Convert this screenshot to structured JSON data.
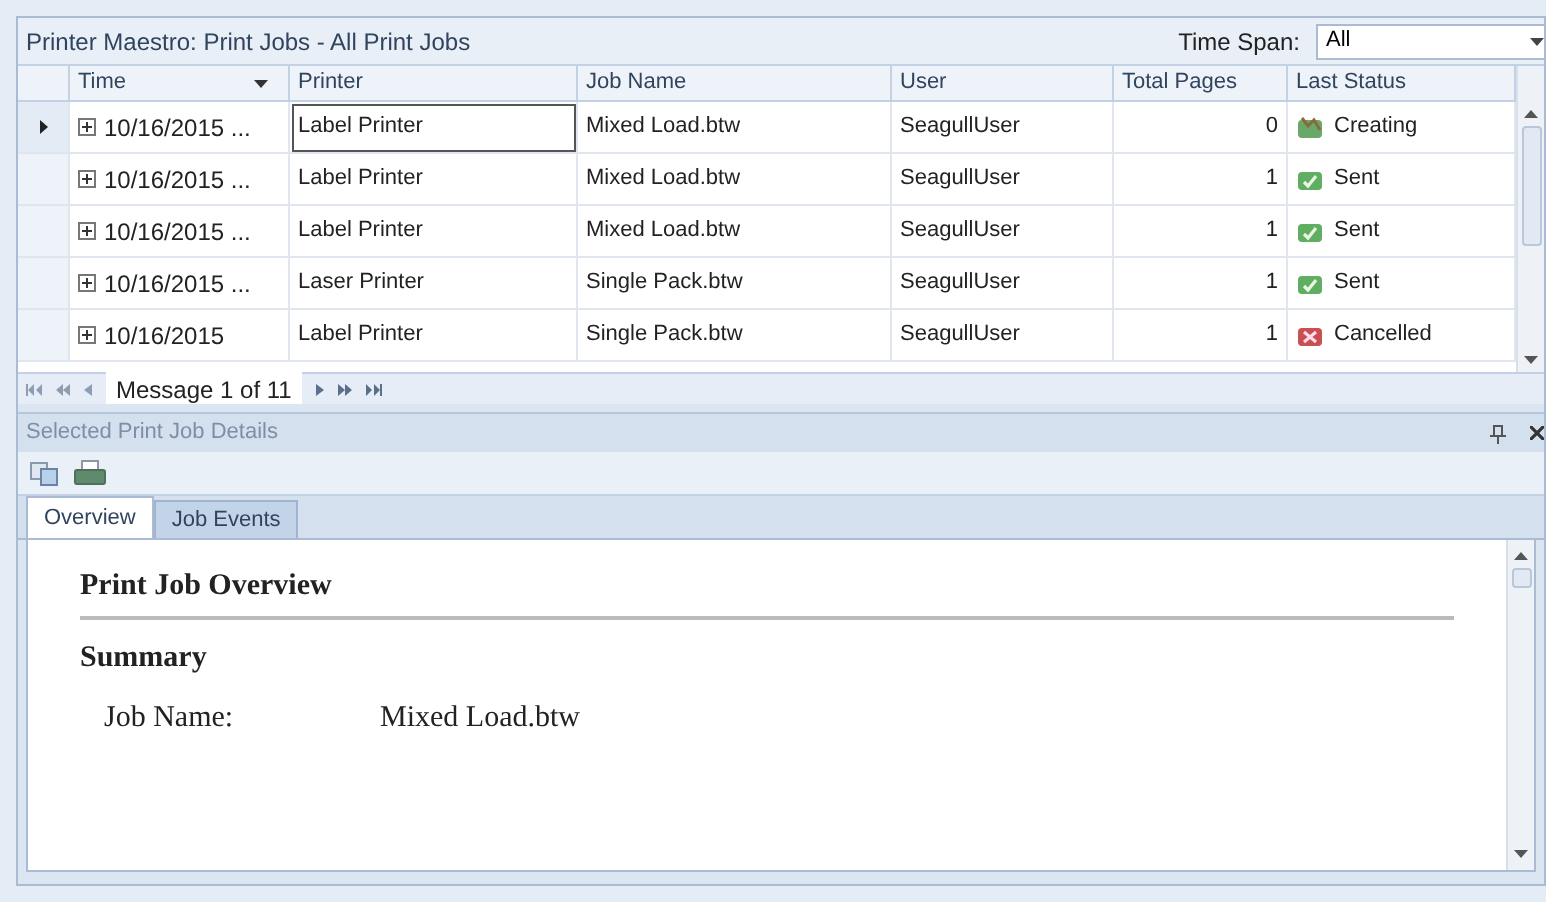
{
  "window": {
    "title": "Printer Maestro: Print Jobs - All Print Jobs"
  },
  "time_span": {
    "label": "Time Span:",
    "value": "All"
  },
  "table": {
    "columns": [
      {
        "label": "Time",
        "sorted": true
      },
      {
        "label": "Printer",
        "sorted": false
      },
      {
        "label": "Job Name",
        "sorted": false
      },
      {
        "label": "User",
        "sorted": false
      },
      {
        "label": "Total Pages",
        "sorted": false
      },
      {
        "label": "Last Status",
        "sorted": false
      }
    ],
    "rows": [
      {
        "selected": true,
        "time": "10/16/2015 ...",
        "printer": "Label Printer",
        "job_name": "Mixed Load.btw",
        "user": "SeagullUser",
        "total_pages": "0",
        "status": {
          "kind": "creating",
          "label": "Creating"
        }
      },
      {
        "selected": false,
        "time": "10/16/2015 ...",
        "printer": "Label Printer",
        "job_name": "Mixed Load.btw",
        "user": "SeagullUser",
        "total_pages": "1",
        "status": {
          "kind": "sent",
          "label": "Sent"
        }
      },
      {
        "selected": false,
        "time": "10/16/2015 ...",
        "printer": "Label Printer",
        "job_name": "Mixed Load.btw",
        "user": "SeagullUser",
        "total_pages": "1",
        "status": {
          "kind": "sent",
          "label": "Sent"
        }
      },
      {
        "selected": false,
        "time": "10/16/2015 ...",
        "printer": "Laser Printer",
        "job_name": "Single Pack.btw",
        "user": "SeagullUser",
        "total_pages": "1",
        "status": {
          "kind": "sent",
          "label": "Sent"
        }
      },
      {
        "selected": false,
        "time": "10/16/2015",
        "printer": "Label Printer",
        "job_name": "Single Pack.btw",
        "user": "SeagullUser",
        "total_pages": "1",
        "status": {
          "kind": "cancelled",
          "label": "Cancelled"
        }
      }
    ]
  },
  "pager": {
    "text": "Message 1 of 11"
  },
  "details": {
    "title": "Selected Print Job Details",
    "tabs": [
      {
        "label": "Overview",
        "selected": true
      },
      {
        "label": "Job Events",
        "selected": false
      }
    ],
    "report": {
      "heading": "Print Job Overview",
      "section": "Summary",
      "fields": [
        {
          "label": "Job Name:",
          "value": "Mixed Load.btw"
        }
      ]
    }
  }
}
